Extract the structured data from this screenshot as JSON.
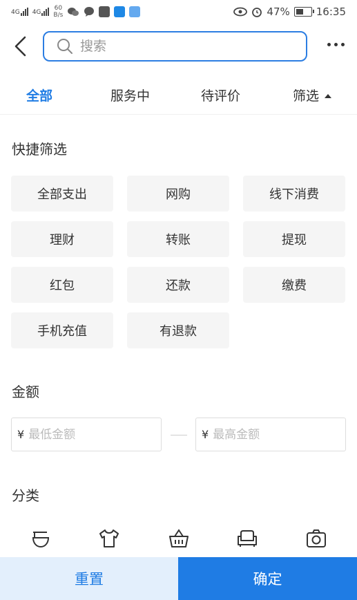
{
  "status_bar": {
    "net1": "4G",
    "net2": "4G",
    "speed_value": "60",
    "speed_unit": "B/s",
    "battery": "47%",
    "time": "16:35"
  },
  "header": {
    "search_placeholder": "搜索"
  },
  "tabs": [
    {
      "label": "全部",
      "active": true
    },
    {
      "label": "服务中",
      "active": false
    },
    {
      "label": "待评价",
      "active": false
    },
    {
      "label": "筛选",
      "active": false
    }
  ],
  "quick_filter": {
    "title": "快捷筛选",
    "options": [
      "全部支出",
      "网购",
      "线下消费",
      "理财",
      "转账",
      "提现",
      "红包",
      "还款",
      "缴费",
      "手机充值",
      "有退款"
    ]
  },
  "amount": {
    "title": "金额",
    "currency": "¥",
    "min_placeholder": "最低金额",
    "max_placeholder": "最高金额"
  },
  "category": {
    "title": "分类",
    "icons": [
      "food-bowl-icon",
      "clothing-icon",
      "shopping-basket-icon",
      "sofa-icon",
      "camera-icon"
    ]
  },
  "buttons": {
    "reset": "重置",
    "confirm": "确定"
  },
  "colors": {
    "accent": "#1f7ce4",
    "reset_bg": "#e3effc",
    "chip_bg": "#f5f5f5"
  }
}
